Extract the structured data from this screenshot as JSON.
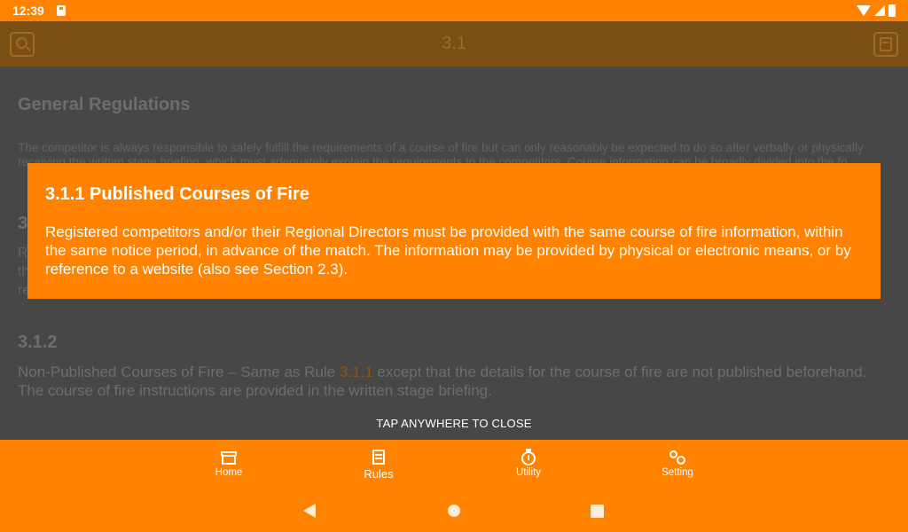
{
  "status_bar": {
    "time": "12:39"
  },
  "app_bar": {
    "title": "3.1"
  },
  "content": {
    "section_title": "General Regulations",
    "intro_text": "The competitor is always responsible to safely fulfill the requirements of a course of fire but can only reasonably be expected to do so after verbally or physically receiving the written stage briefing, which must adequately explain the requirements to the competitors. Course information can be broadly divided into the fo",
    "sub_311_title_fragment": "3",
    "sub_311_text_fragment": "Re\nth\nre",
    "sub_312_title": "3.1.2",
    "sub_312_text_before": "Non-Published Courses of Fire – Same as Rule ",
    "sub_312_link": "3.1.1",
    "sub_312_text_after": " except that the details for the course of fire are not published beforehand. The course of fire instructions are provided in the written stage briefing.",
    "tap_to_close": "TAP ANYWHERE TO CLOSE"
  },
  "popup": {
    "title": "3.1.1 Published Courses of Fire",
    "text": "Registered competitors and/or their Regional Directors must be provided with the same course of fire information, within the same notice period, in advance of the match. The information may be provided by physical or electronic means, or by reference to a website (also see Section 2.3)."
  },
  "bottom_nav": {
    "items": [
      {
        "label": "Home",
        "icon": "home-icon"
      },
      {
        "label": "Rules",
        "icon": "rules-icon"
      },
      {
        "label": "Utility",
        "icon": "stopwatch-icon"
      },
      {
        "label": "Setting",
        "icon": "gears-icon"
      }
    ],
    "active": "Rules"
  },
  "colors": {
    "accent": "#ff8200",
    "overlay_bg": "#474747",
    "app_bar_dimmed": "#7a4f14"
  }
}
